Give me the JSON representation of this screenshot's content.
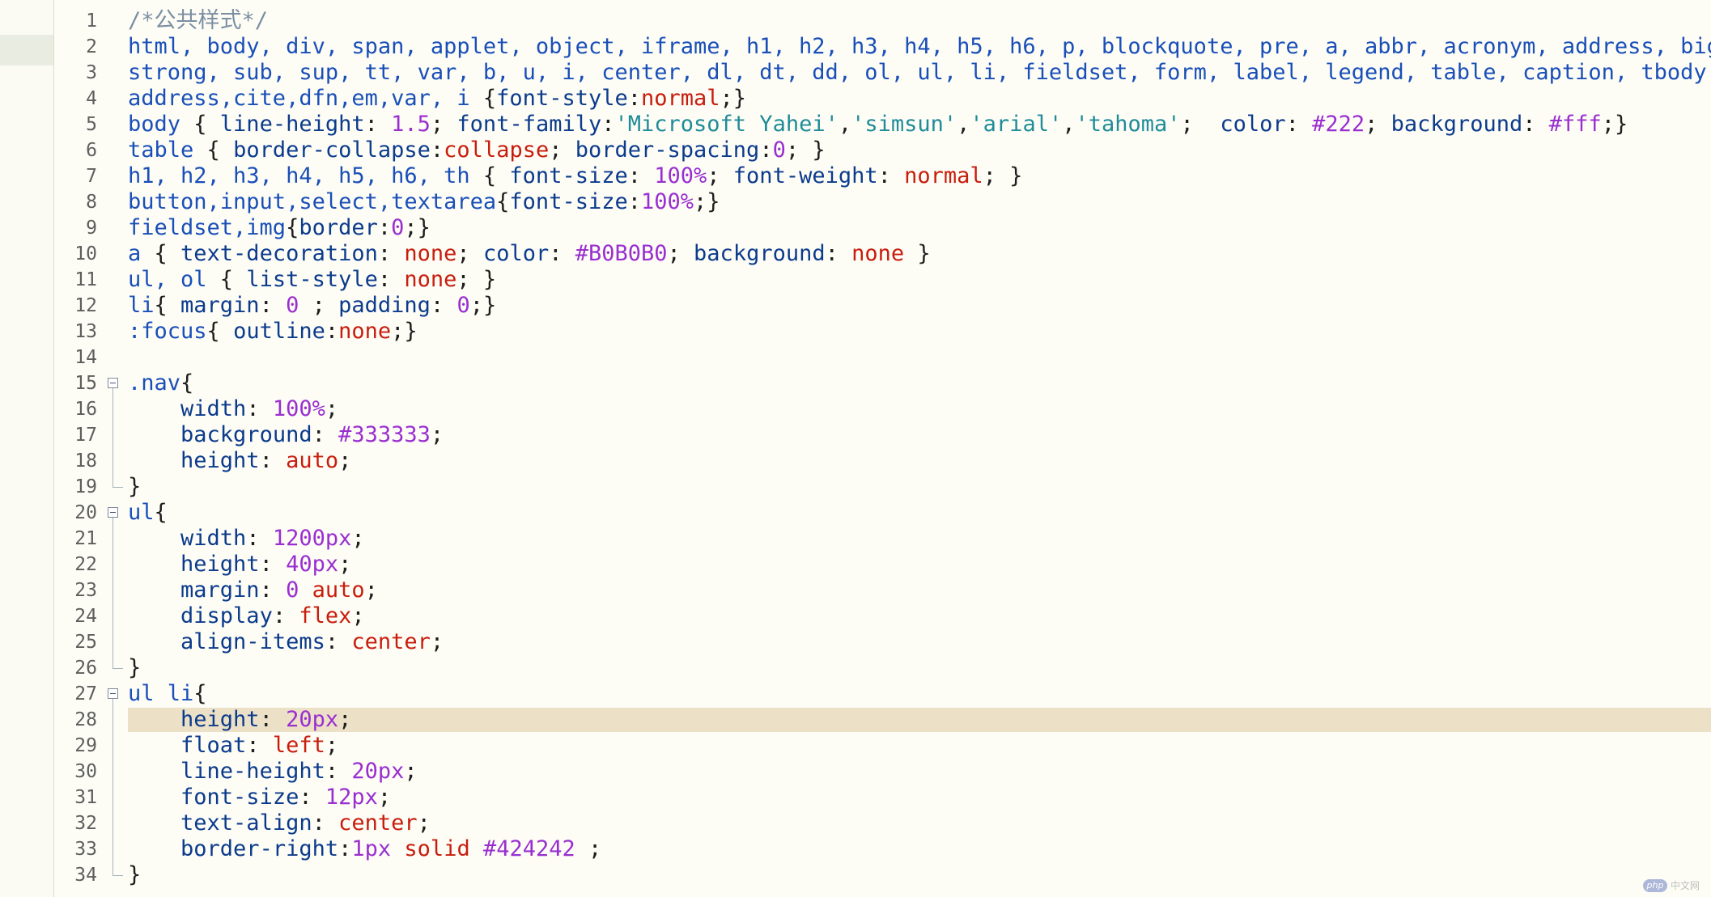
{
  "editor": {
    "current_line": 28,
    "lines": [
      {
        "n": "1",
        "tokens": [
          {
            "t": "/*公共样式*/",
            "c": "c"
          }
        ]
      },
      {
        "n": "2",
        "tokens": [
          {
            "t": "html, body, div, span, applet, object, iframe, h1, h2, h3, h4, h5, h6, p, blockquote, pre, a, abbr, acronym, address, big, cite",
            "c": "k"
          }
        ]
      },
      {
        "n": "3",
        "tokens": [
          {
            "t": "strong, sub, sup, tt, var, b, u, i, center, dl, dt, dd, ol, ul, li, fieldset, form, label, legend, table, caption, tbody,tfoot,",
            "c": "k"
          }
        ]
      },
      {
        "n": "4",
        "tokens": [
          {
            "t": "address,cite,dfn,em,var, i ",
            "c": "k"
          },
          {
            "t": "{",
            "c": "o"
          },
          {
            "t": "font-style",
            "c": "p"
          },
          {
            "t": ":",
            "c": "o"
          },
          {
            "t": "normal",
            "c": "v"
          },
          {
            "t": ";}",
            "c": "o"
          }
        ]
      },
      {
        "n": "5",
        "tokens": [
          {
            "t": "body ",
            "c": "k"
          },
          {
            "t": "{ ",
            "c": "o"
          },
          {
            "t": "line-height",
            "c": "p"
          },
          {
            "t": ": ",
            "c": "o"
          },
          {
            "t": "1.5",
            "c": "n"
          },
          {
            "t": "; ",
            "c": "o"
          },
          {
            "t": "font-family",
            "c": "p"
          },
          {
            "t": ":",
            "c": "o"
          },
          {
            "t": "'Microsoft Yahei'",
            "c": "s"
          },
          {
            "t": ",",
            "c": "o"
          },
          {
            "t": "'simsun'",
            "c": "s"
          },
          {
            "t": ",",
            "c": "o"
          },
          {
            "t": "'arial'",
            "c": "s"
          },
          {
            "t": ",",
            "c": "o"
          },
          {
            "t": "'tahoma'",
            "c": "s"
          },
          {
            "t": ";  ",
            "c": "o"
          },
          {
            "t": "color",
            "c": "p"
          },
          {
            "t": ": ",
            "c": "o"
          },
          {
            "t": "#222",
            "c": "n"
          },
          {
            "t": "; ",
            "c": "o"
          },
          {
            "t": "background",
            "c": "p"
          },
          {
            "t": ": ",
            "c": "o"
          },
          {
            "t": "#fff",
            "c": "n"
          },
          {
            "t": ";}",
            "c": "o"
          }
        ]
      },
      {
        "n": "6",
        "tokens": [
          {
            "t": "table ",
            "c": "k"
          },
          {
            "t": "{ ",
            "c": "o"
          },
          {
            "t": "border-collapse",
            "c": "p"
          },
          {
            "t": ":",
            "c": "o"
          },
          {
            "t": "collapse",
            "c": "v"
          },
          {
            "t": "; ",
            "c": "o"
          },
          {
            "t": "border-spacing",
            "c": "p"
          },
          {
            "t": ":",
            "c": "o"
          },
          {
            "t": "0",
            "c": "n"
          },
          {
            "t": "; }",
            "c": "o"
          }
        ]
      },
      {
        "n": "7",
        "tokens": [
          {
            "t": "h1, h2, h3, h4, h5, h6, th ",
            "c": "k"
          },
          {
            "t": "{ ",
            "c": "o"
          },
          {
            "t": "font-size",
            "c": "p"
          },
          {
            "t": ": ",
            "c": "o"
          },
          {
            "t": "100%",
            "c": "n"
          },
          {
            "t": "; ",
            "c": "o"
          },
          {
            "t": "font-weight",
            "c": "p"
          },
          {
            "t": ": ",
            "c": "o"
          },
          {
            "t": "normal",
            "c": "v"
          },
          {
            "t": "; }",
            "c": "o"
          }
        ]
      },
      {
        "n": "8",
        "tokens": [
          {
            "t": "button,input,select,textarea",
            "c": "k"
          },
          {
            "t": "{",
            "c": "o"
          },
          {
            "t": "font-size",
            "c": "p"
          },
          {
            "t": ":",
            "c": "o"
          },
          {
            "t": "100%",
            "c": "n"
          },
          {
            "t": ";}",
            "c": "o"
          }
        ]
      },
      {
        "n": "9",
        "tokens": [
          {
            "t": "fieldset,img",
            "c": "k"
          },
          {
            "t": "{",
            "c": "o"
          },
          {
            "t": "border",
            "c": "p"
          },
          {
            "t": ":",
            "c": "o"
          },
          {
            "t": "0",
            "c": "n"
          },
          {
            "t": ";}",
            "c": "o"
          }
        ]
      },
      {
        "n": "10",
        "tokens": [
          {
            "t": "a ",
            "c": "k"
          },
          {
            "t": "{ ",
            "c": "o"
          },
          {
            "t": "text-decoration",
            "c": "p"
          },
          {
            "t": ": ",
            "c": "o"
          },
          {
            "t": "none",
            "c": "v"
          },
          {
            "t": "; ",
            "c": "o"
          },
          {
            "t": "color",
            "c": "p"
          },
          {
            "t": ": ",
            "c": "o"
          },
          {
            "t": "#B0B0B0",
            "c": "n"
          },
          {
            "t": "; ",
            "c": "o"
          },
          {
            "t": "background",
            "c": "p"
          },
          {
            "t": ": ",
            "c": "o"
          },
          {
            "t": "none",
            "c": "v"
          },
          {
            "t": " }",
            "c": "o"
          }
        ]
      },
      {
        "n": "11",
        "tokens": [
          {
            "t": "ul, ol ",
            "c": "k"
          },
          {
            "t": "{ ",
            "c": "o"
          },
          {
            "t": "list-style",
            "c": "p"
          },
          {
            "t": ": ",
            "c": "o"
          },
          {
            "t": "none",
            "c": "v"
          },
          {
            "t": "; }",
            "c": "o"
          }
        ]
      },
      {
        "n": "12",
        "tokens": [
          {
            "t": "li",
            "c": "k"
          },
          {
            "t": "{ ",
            "c": "o"
          },
          {
            "t": "margin",
            "c": "p"
          },
          {
            "t": ": ",
            "c": "o"
          },
          {
            "t": "0",
            "c": "n"
          },
          {
            "t": " ; ",
            "c": "o"
          },
          {
            "t": "padding",
            "c": "p"
          },
          {
            "t": ": ",
            "c": "o"
          },
          {
            "t": "0",
            "c": "n"
          },
          {
            "t": ";}",
            "c": "o"
          }
        ]
      },
      {
        "n": "13",
        "tokens": [
          {
            "t": ":focus",
            "c": "k"
          },
          {
            "t": "{ ",
            "c": "o"
          },
          {
            "t": "outline",
            "c": "p"
          },
          {
            "t": ":",
            "c": "o"
          },
          {
            "t": "none",
            "c": "v"
          },
          {
            "t": ";}",
            "c": "o"
          }
        ]
      },
      {
        "n": "14",
        "tokens": []
      },
      {
        "n": "15",
        "fold": "start",
        "tokens": [
          {
            "t": ".nav",
            "c": "k"
          },
          {
            "t": "{",
            "c": "o"
          }
        ]
      },
      {
        "n": "16",
        "fold": "mid",
        "tokens": [
          {
            "t": "    ",
            "c": "o"
          },
          {
            "t": "width",
            "c": "p"
          },
          {
            "t": ": ",
            "c": "o"
          },
          {
            "t": "100%",
            "c": "n"
          },
          {
            "t": ";",
            "c": "o"
          }
        ]
      },
      {
        "n": "17",
        "fold": "mid",
        "tokens": [
          {
            "t": "    ",
            "c": "o"
          },
          {
            "t": "background",
            "c": "p"
          },
          {
            "t": ": ",
            "c": "o"
          },
          {
            "t": "#333333",
            "c": "n"
          },
          {
            "t": ";",
            "c": "o"
          }
        ]
      },
      {
        "n": "18",
        "fold": "mid",
        "tokens": [
          {
            "t": "    ",
            "c": "o"
          },
          {
            "t": "height",
            "c": "p"
          },
          {
            "t": ": ",
            "c": "o"
          },
          {
            "t": "auto",
            "c": "v"
          },
          {
            "t": ";",
            "c": "o"
          }
        ]
      },
      {
        "n": "19",
        "fold": "end",
        "tokens": [
          {
            "t": "}",
            "c": "o"
          }
        ]
      },
      {
        "n": "20",
        "fold": "start",
        "tokens": [
          {
            "t": "ul",
            "c": "k"
          },
          {
            "t": "{",
            "c": "o"
          }
        ]
      },
      {
        "n": "21",
        "fold": "mid",
        "tokens": [
          {
            "t": "    ",
            "c": "o"
          },
          {
            "t": "width",
            "c": "p"
          },
          {
            "t": ": ",
            "c": "o"
          },
          {
            "t": "1200px",
            "c": "n"
          },
          {
            "t": ";",
            "c": "o"
          }
        ]
      },
      {
        "n": "22",
        "fold": "mid",
        "tokens": [
          {
            "t": "    ",
            "c": "o"
          },
          {
            "t": "height",
            "c": "p"
          },
          {
            "t": ": ",
            "c": "o"
          },
          {
            "t": "40px",
            "c": "n"
          },
          {
            "t": ";",
            "c": "o"
          }
        ]
      },
      {
        "n": "23",
        "fold": "mid",
        "tokens": [
          {
            "t": "    ",
            "c": "o"
          },
          {
            "t": "margin",
            "c": "p"
          },
          {
            "t": ": ",
            "c": "o"
          },
          {
            "t": "0",
            "c": "n"
          },
          {
            "t": " ",
            "c": "o"
          },
          {
            "t": "auto",
            "c": "v"
          },
          {
            "t": ";",
            "c": "o"
          }
        ]
      },
      {
        "n": "24",
        "fold": "mid",
        "tokens": [
          {
            "t": "    ",
            "c": "o"
          },
          {
            "t": "display",
            "c": "p"
          },
          {
            "t": ": ",
            "c": "o"
          },
          {
            "t": "flex",
            "c": "v"
          },
          {
            "t": ";",
            "c": "o"
          }
        ]
      },
      {
        "n": "25",
        "fold": "mid",
        "tokens": [
          {
            "t": "    ",
            "c": "o"
          },
          {
            "t": "align-items",
            "c": "p"
          },
          {
            "t": ": ",
            "c": "o"
          },
          {
            "t": "center",
            "c": "v"
          },
          {
            "t": ";",
            "c": "o"
          }
        ]
      },
      {
        "n": "26",
        "fold": "end",
        "tokens": [
          {
            "t": "}",
            "c": "o"
          }
        ]
      },
      {
        "n": "27",
        "fold": "start",
        "tokens": [
          {
            "t": "ul li",
            "c": "k"
          },
          {
            "t": "{",
            "c": "o"
          }
        ]
      },
      {
        "n": "28",
        "fold": "mid",
        "tokens": [
          {
            "t": "    ",
            "c": "o"
          },
          {
            "t": "height",
            "c": "p"
          },
          {
            "t": ": ",
            "c": "o"
          },
          {
            "t": "20px",
            "c": "n"
          },
          {
            "t": ";",
            "c": "o"
          }
        ]
      },
      {
        "n": "29",
        "fold": "mid",
        "tokens": [
          {
            "t": "    ",
            "c": "o"
          },
          {
            "t": "float",
            "c": "p"
          },
          {
            "t": ": ",
            "c": "o"
          },
          {
            "t": "left",
            "c": "v"
          },
          {
            "t": ";",
            "c": "o"
          }
        ]
      },
      {
        "n": "30",
        "fold": "mid",
        "tokens": [
          {
            "t": "    ",
            "c": "o"
          },
          {
            "t": "line-height",
            "c": "p"
          },
          {
            "t": ": ",
            "c": "o"
          },
          {
            "t": "20px",
            "c": "n"
          },
          {
            "t": ";",
            "c": "o"
          }
        ]
      },
      {
        "n": "31",
        "fold": "mid",
        "tokens": [
          {
            "t": "    ",
            "c": "o"
          },
          {
            "t": "font-size",
            "c": "p"
          },
          {
            "t": ": ",
            "c": "o"
          },
          {
            "t": "12px",
            "c": "n"
          },
          {
            "t": ";",
            "c": "o"
          }
        ]
      },
      {
        "n": "32",
        "fold": "mid",
        "tokens": [
          {
            "t": "    ",
            "c": "o"
          },
          {
            "t": "text-align",
            "c": "p"
          },
          {
            "t": ": ",
            "c": "o"
          },
          {
            "t": "center",
            "c": "v"
          },
          {
            "t": ";",
            "c": "o"
          }
        ]
      },
      {
        "n": "33",
        "fold": "mid",
        "tokens": [
          {
            "t": "    ",
            "c": "o"
          },
          {
            "t": "border-right",
            "c": "p"
          },
          {
            "t": ":",
            "c": "o"
          },
          {
            "t": "1px",
            "c": "n"
          },
          {
            "t": " ",
            "c": "o"
          },
          {
            "t": "solid",
            "c": "v"
          },
          {
            "t": " ",
            "c": "o"
          },
          {
            "t": "#424242",
            "c": "n"
          },
          {
            "t": " ;",
            "c": "o"
          }
        ]
      },
      {
        "n": "34",
        "fold": "end",
        "tokens": [
          {
            "t": "}",
            "c": "o"
          }
        ]
      }
    ]
  },
  "watermark": {
    "logo": "php",
    "text": "中文网"
  }
}
